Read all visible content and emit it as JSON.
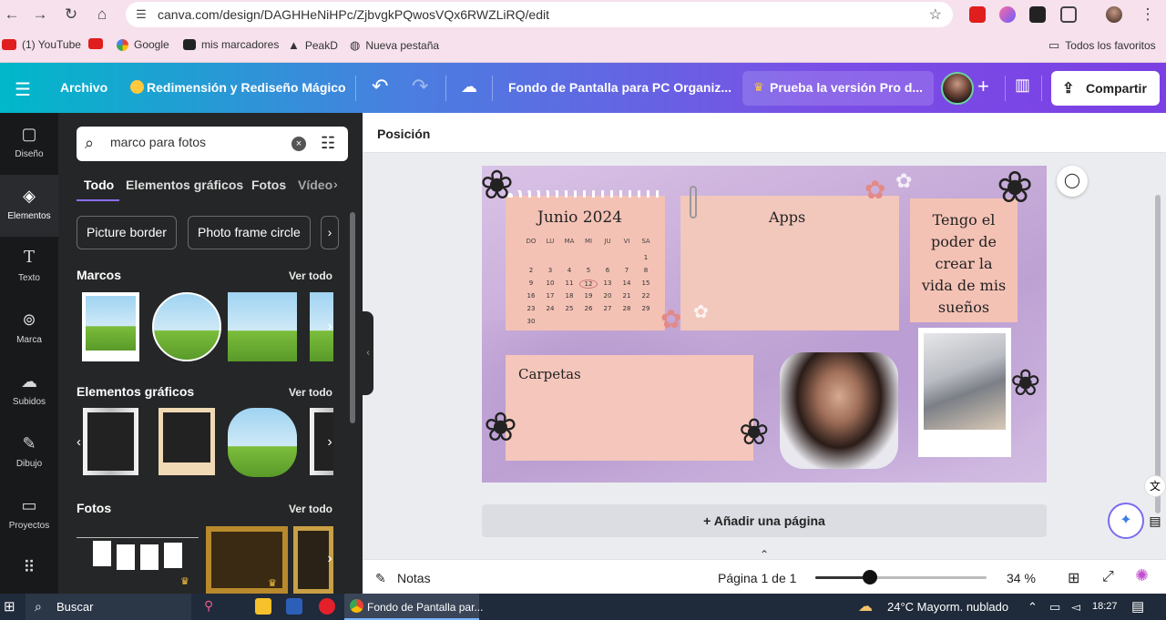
{
  "browser": {
    "url": "canva.com/design/DAGHHeNiHPc/ZjbvgkPQwosVQx6RWZLiRQ/edit",
    "bookmarks": [
      "(1) YouTube",
      "Google",
      "mis marcadores",
      "PeakD",
      "Nueva pestaña"
    ],
    "all_favorites": "Todos los favoritos"
  },
  "header": {
    "file": "Archivo",
    "magic": "Redimensión y Rediseño Mágico",
    "doc_title": "Fondo de Pantalla para PC Organiz...",
    "pro": "Prueba la versión Pro d...",
    "share": "Compartir"
  },
  "rail": [
    "Diseño",
    "Elementos",
    "Texto",
    "Marca",
    "Subidos",
    "Dibujo",
    "Proyectos"
  ],
  "panel": {
    "search_value": "marco para fotos",
    "tabs": [
      "Todo",
      "Elementos gráficos",
      "Fotos",
      "Vídeo"
    ],
    "chips": [
      "Picture border",
      "Photo frame circle"
    ],
    "sections": {
      "frames": "Marcos",
      "graphics": "Elementos gráficos",
      "photos": "Fotos"
    },
    "see_all": "Ver todo"
  },
  "workspace": {
    "position": "Posición",
    "add_page": "+ Añadir una página"
  },
  "design": {
    "calendar_title": "Junio 2024",
    "weekdays": [
      "DO",
      "LU",
      "MA",
      "MI",
      "JU",
      "VI",
      "SA"
    ],
    "days": [
      "1",
      "2",
      "3",
      "4",
      "5",
      "6",
      "7",
      "8",
      "9",
      "10",
      "11",
      "12",
      "13",
      "14",
      "15",
      "16",
      "17",
      "18",
      "19",
      "20",
      "21",
      "22",
      "23",
      "24",
      "25",
      "26",
      "27",
      "28",
      "29",
      "30"
    ],
    "apps": "Apps",
    "folders": "Carpetas",
    "quote_lines": [
      "Tengo el",
      "poder de",
      "crear la",
      "vida de mis",
      "sueños"
    ]
  },
  "bottom": {
    "notes": "Notas",
    "page": "Página 1 de 1",
    "zoom_fraction": 0.32,
    "zoom_label": "34 %"
  },
  "taskbar": {
    "search": "Buscar",
    "app": "Fondo de Pantalla par...",
    "weather": "24°C  Mayorm. nublado",
    "time": "18:27"
  }
}
